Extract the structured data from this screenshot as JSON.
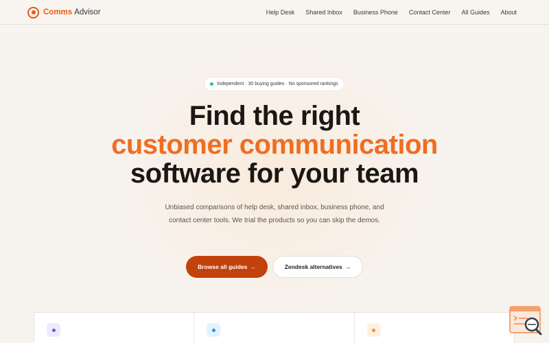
{
  "brand": {
    "name_part1": "Comms",
    "name_part2": "Advisor"
  },
  "nav": {
    "links": [
      "Help Desk",
      "Shared Inbox",
      "Business Phone",
      "Contact Center",
      "All Guides",
      "About"
    ]
  },
  "hero": {
    "pill_text": "Independent · 30 buying guides · No sponsored rankings",
    "headline_line1": "Find the right",
    "headline_line2": "customer communication",
    "headline_line3": "software for your team",
    "subtitle": "Unbiased comparisons of help desk, shared inbox, business phone, and contact center tools. We trial the products so you can skip the demos.",
    "primary_cta": "Browse all guides",
    "secondary_cta": "Zendesk alternatives",
    "arrow": "→"
  },
  "cards": [
    {
      "icon": "dot-icon",
      "icon_bg": "#eceafe",
      "icon_color": "#6a5ae0"
    },
    {
      "icon": "dot-icon",
      "icon_bg": "#e3f3fd",
      "icon_color": "#1a9be6"
    },
    {
      "icon": "dot-icon",
      "icon_bg": "#fdf0e2",
      "icon_color": "#f0961f"
    }
  ],
  "colors": {
    "accent": "#f06d21",
    "primary_button": "#c2410c",
    "status_dot": "#2bbf8a"
  },
  "widget": {
    "icon": "search-docs-icon"
  }
}
